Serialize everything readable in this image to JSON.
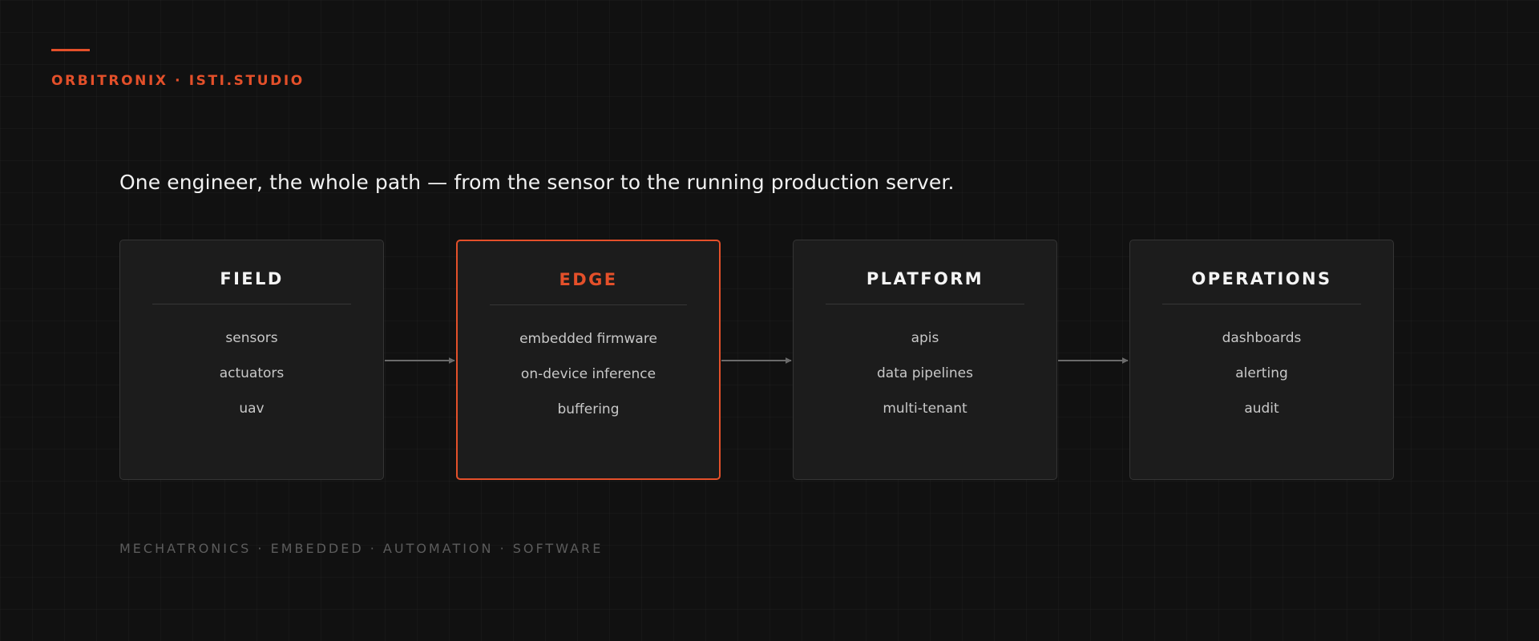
{
  "brand": {
    "name": "ORBITRONIX · ISTI.STUDIO",
    "accent_color": "#e4502a"
  },
  "headline": "One engineer, the whole path — from the sensor to the running production server.",
  "stages": [
    {
      "title": "FIELD",
      "items": [
        "sensors",
        "actuators",
        "uav"
      ],
      "highlighted": false
    },
    {
      "title": "EDGE",
      "items": [
        "embedded firmware",
        "on-device inference",
        "buffering"
      ],
      "highlighted": true
    },
    {
      "title": "PLATFORM",
      "items": [
        "apis",
        "data pipelines",
        "multi-tenant"
      ],
      "highlighted": false
    },
    {
      "title": "OPERATIONS",
      "items": [
        "dashboards",
        "alerting",
        "audit"
      ],
      "highlighted": false
    }
  ],
  "connections": [
    {
      "from": "FIELD",
      "to": "EDGE"
    },
    {
      "from": "EDGE",
      "to": "PLATFORM"
    },
    {
      "from": "PLATFORM",
      "to": "OPERATIONS"
    }
  ],
  "footer": {
    "tags": "MECHATRONICS · EMBEDDED · AUTOMATION · SOFTWARE"
  },
  "colors": {
    "background": "#111111",
    "card": "#1c1c1c",
    "card_border": "#353535",
    "arrow": "#6a6a6a",
    "footer_text": "#5c5c5c"
  }
}
